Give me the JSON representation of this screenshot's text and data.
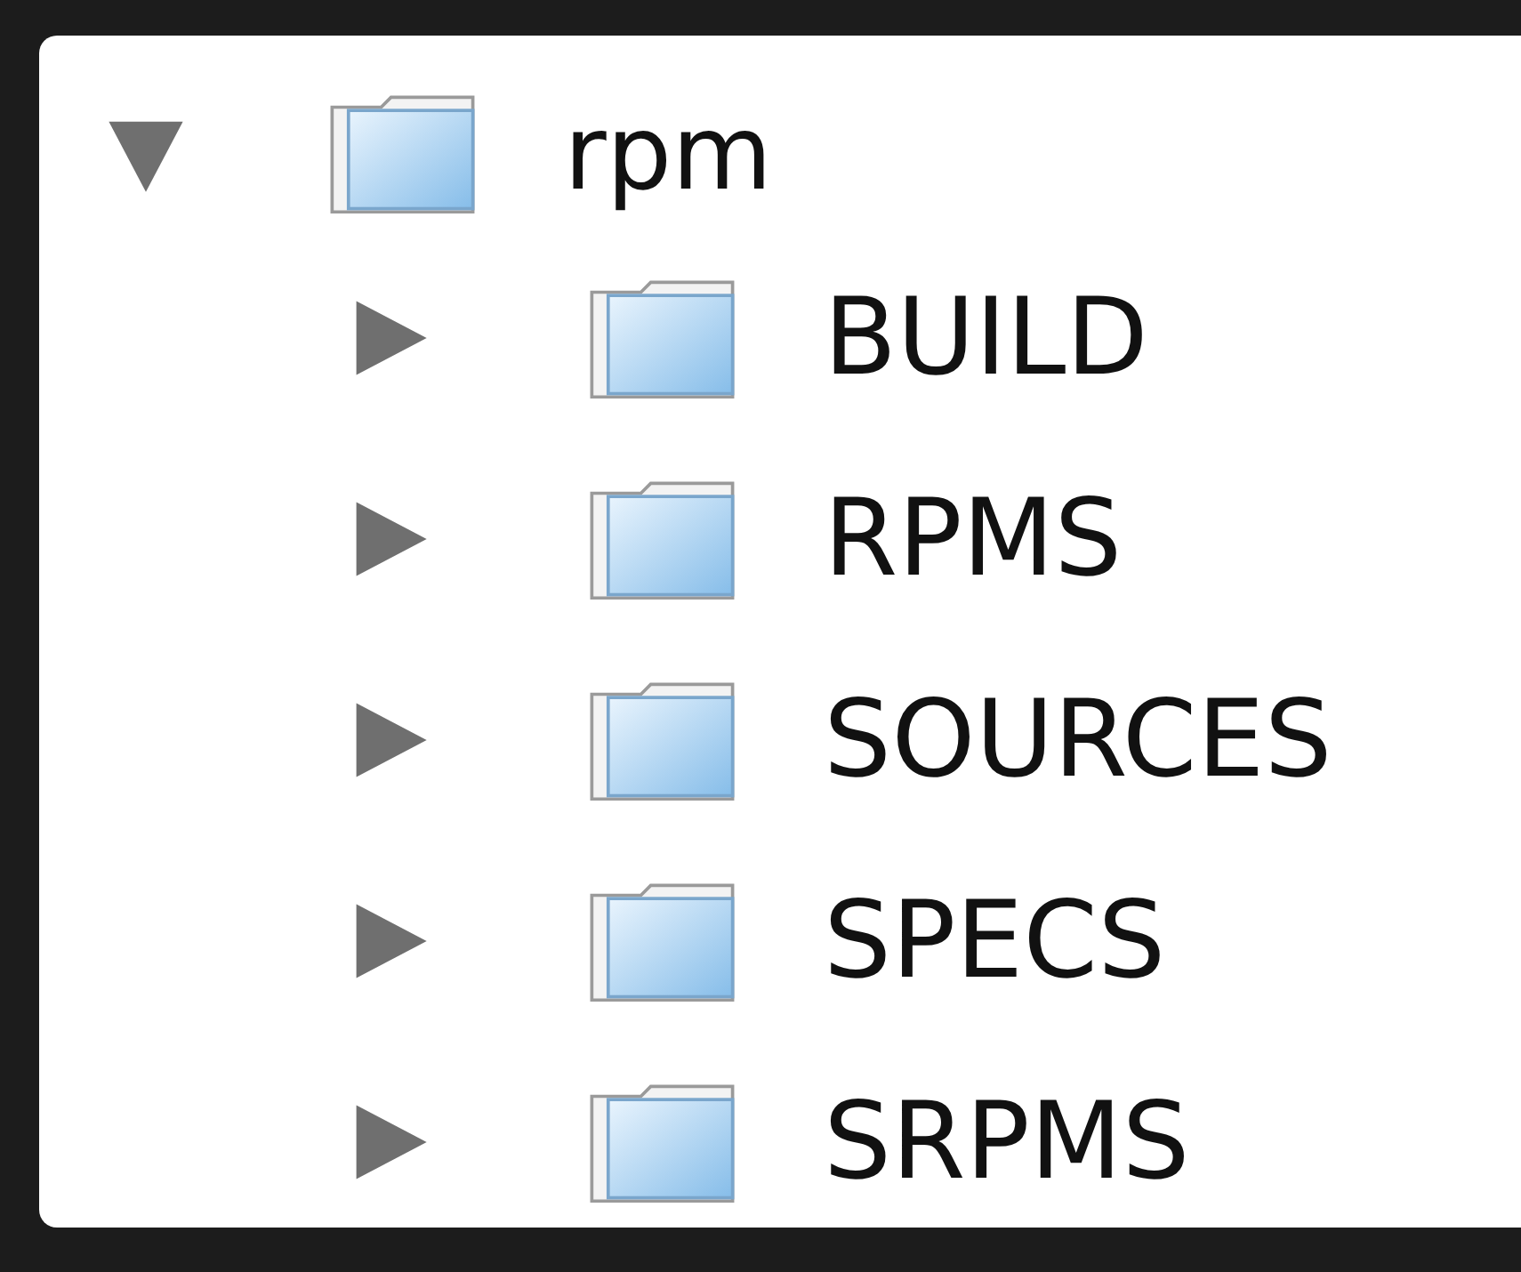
{
  "tree": [
    {
      "label": "rpm",
      "expanded": true,
      "children": [
        {
          "label": "BUILD",
          "expanded": false
        },
        {
          "label": "RPMS",
          "expanded": false
        },
        {
          "label": "SOURCES",
          "expanded": false
        },
        {
          "label": "SPECS",
          "expanded": false
        },
        {
          "label": "SRPMS",
          "expanded": false
        }
      ]
    }
  ]
}
